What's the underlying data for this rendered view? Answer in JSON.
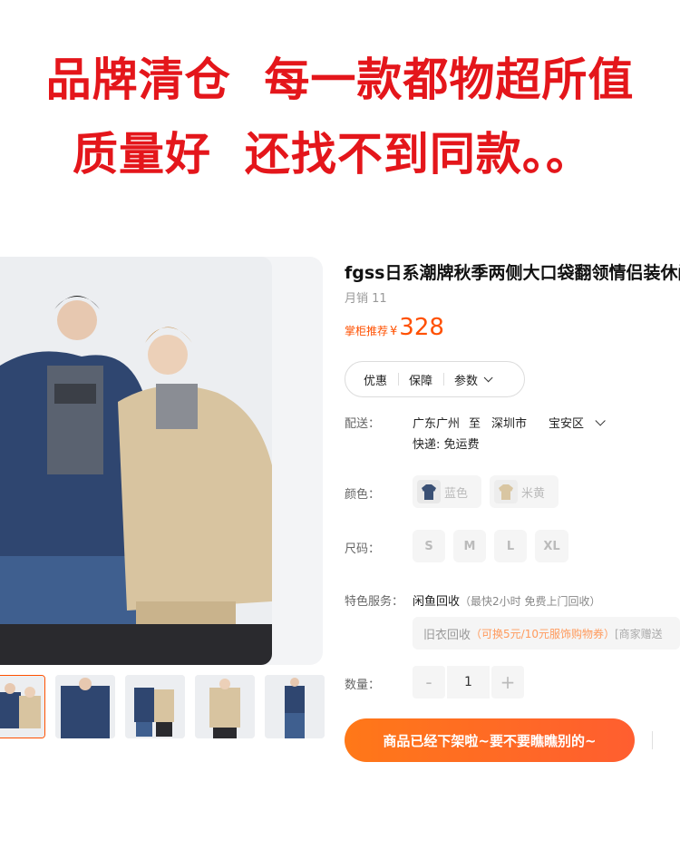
{
  "banner": {
    "line1": "品牌清仓  每一款都物超所值",
    "line2": "质量好  还找不到同款。。"
  },
  "product": {
    "title": "fgss日系潮牌秋季两侧大口袋翻领情侣装休闲",
    "sales": "月销 11",
    "price_label": "掌柜推荐",
    "currency": "¥",
    "price": "328"
  },
  "info_tabs": [
    "优惠",
    "保障",
    "参数"
  ],
  "shipping": {
    "label": "配送：",
    "from": "广东广州",
    "to_word": "至",
    "city": "深圳市",
    "district": "宝安区",
    "fee": "快递: 免运费"
  },
  "color": {
    "label": "颜色：",
    "options": [
      "蓝色",
      "米黄"
    ],
    "swatch_colors": [
      "#3a5074",
      "#d9c6a2"
    ]
  },
  "size": {
    "label": "尺码：",
    "options": [
      "S",
      "M",
      "L",
      "XL"
    ]
  },
  "service": {
    "label": "特色服务：",
    "name": "闲鱼回收",
    "detail": "（最快2小时 免费上门回收）",
    "recycle_name": "旧衣回收",
    "recycle_offer": "（可换5元/10元服饰购物券）",
    "recycle_extra": "[商家赠送"
  },
  "quantity": {
    "label": "数量：",
    "minus": "-",
    "value": "1",
    "plus": "+"
  },
  "cta": {
    "label": "商品已经下架啦~要不要瞧瞧别的~"
  },
  "colors": {
    "accent": "#ff5000",
    "banner_red": "#e4161b"
  }
}
